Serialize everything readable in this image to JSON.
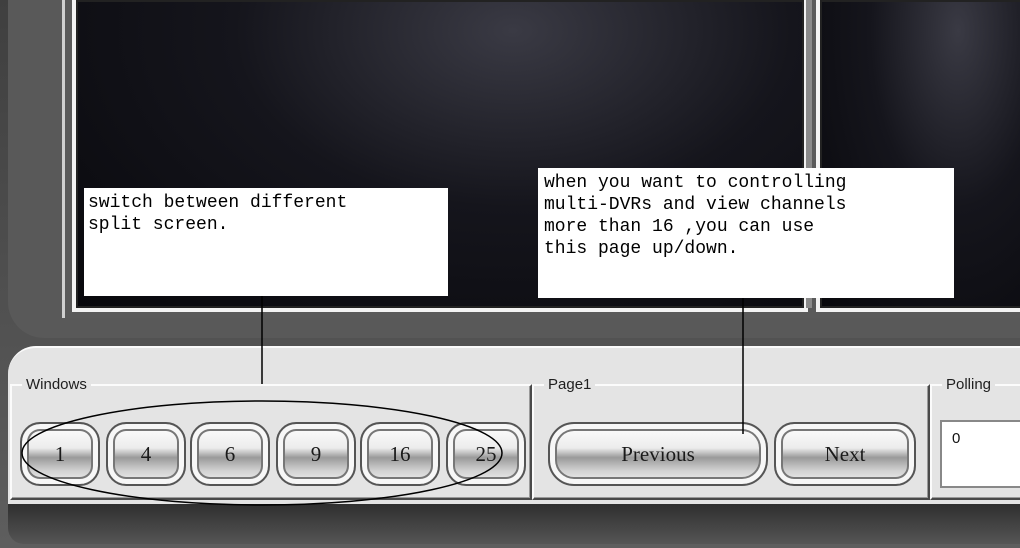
{
  "annotations": {
    "split_screen_note": "switch between different\nsplit screen.",
    "page_note": "when you want to controlling\nmulti-DVRs and view channels\nmore than 16 ,you can use\nthis page up/down."
  },
  "windows_group": {
    "legend": "Windows",
    "buttons": [
      "1",
      "4",
      "6",
      "9",
      "16",
      "25"
    ]
  },
  "page_group": {
    "legend": "Page1",
    "previous_label": "Previous",
    "next_label": "Next"
  },
  "polling_group": {
    "legend": "Polling",
    "value": "0"
  },
  "colors": {
    "panel": "#e4e4e4",
    "video": "#0c0c12",
    "frame": "#555555"
  }
}
